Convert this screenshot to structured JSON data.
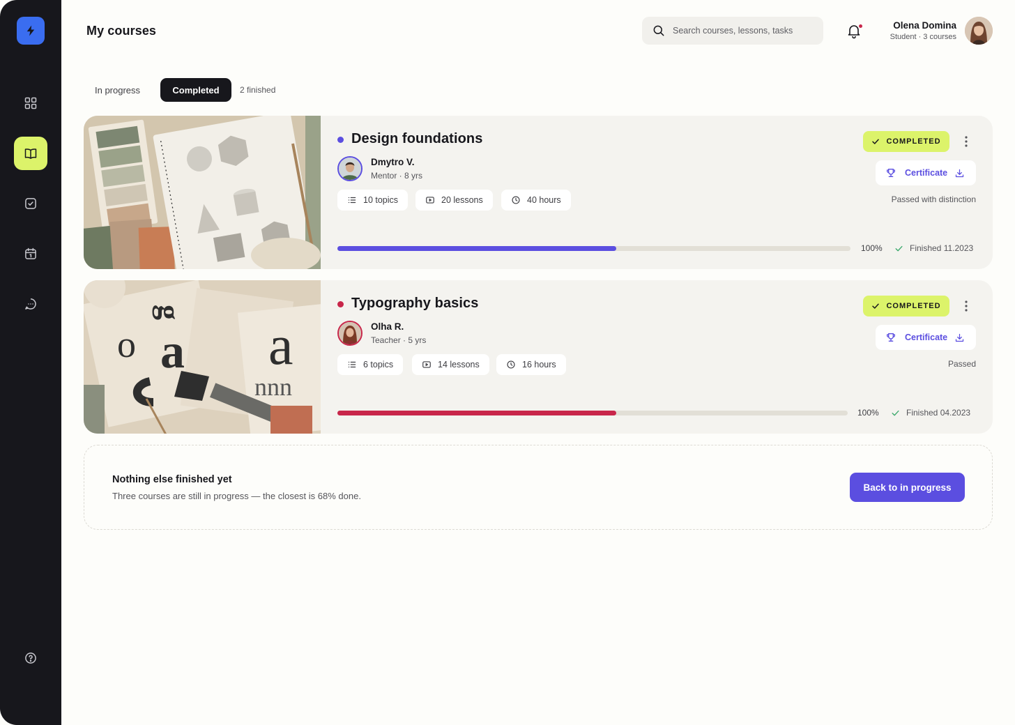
{
  "header": {
    "title": "My courses",
    "search_placeholder": "Search courses, lessons, tasks",
    "user": {
      "name": "Olena Domina",
      "subtitle": "Student · 3 courses"
    }
  },
  "sidebar": {
    "items": [
      {
        "icon": "dashboard-grid-icon",
        "active": false
      },
      {
        "icon": "book-icon",
        "active": true
      },
      {
        "icon": "checkbox-icon",
        "active": false
      },
      {
        "icon": "calendar-icon",
        "active": false
      },
      {
        "icon": "chat-icon",
        "active": false
      }
    ],
    "help_icon": "help-icon"
  },
  "tabs": {
    "in_progress": "In progress",
    "completed": "Completed",
    "count": "2 finished"
  },
  "courses": [
    {
      "title": "Design foundations",
      "accent": "#5b4ee0",
      "mentor": {
        "name": "Dmytro V.",
        "role": "Mentor · 8 yrs"
      },
      "topics": "10 topics",
      "lessons": "20 lessons",
      "hours": "40 hours",
      "status": "COMPLETED",
      "certificate": "Certificate",
      "result": "Passed with distinction",
      "progress": 100,
      "progress_label": "100%",
      "finished": "Finished 11.2023"
    },
    {
      "title": "Typography basics",
      "accent": "#c8264a",
      "mentor": {
        "name": "Olha R.",
        "role": "Teacher · 5 yrs"
      },
      "topics": "6 topics",
      "lessons": "14 lessons",
      "hours": "16 hours",
      "status": "COMPLETED",
      "certificate": "Certificate",
      "result": "Passed",
      "progress": 100,
      "progress_label": "100%",
      "finished": "Finished 04.2023"
    }
  ],
  "empty_state": {
    "title": "Nothing else finished yet",
    "subtitle": "Three courses are still in progress — the closest is 68% done.",
    "button": "Back to in progress"
  },
  "colors": {
    "sidebar_bg": "#17171c",
    "accent_lime": "#dcf36a",
    "primary": "#5b4ee0",
    "logo": "#3a6df0"
  }
}
